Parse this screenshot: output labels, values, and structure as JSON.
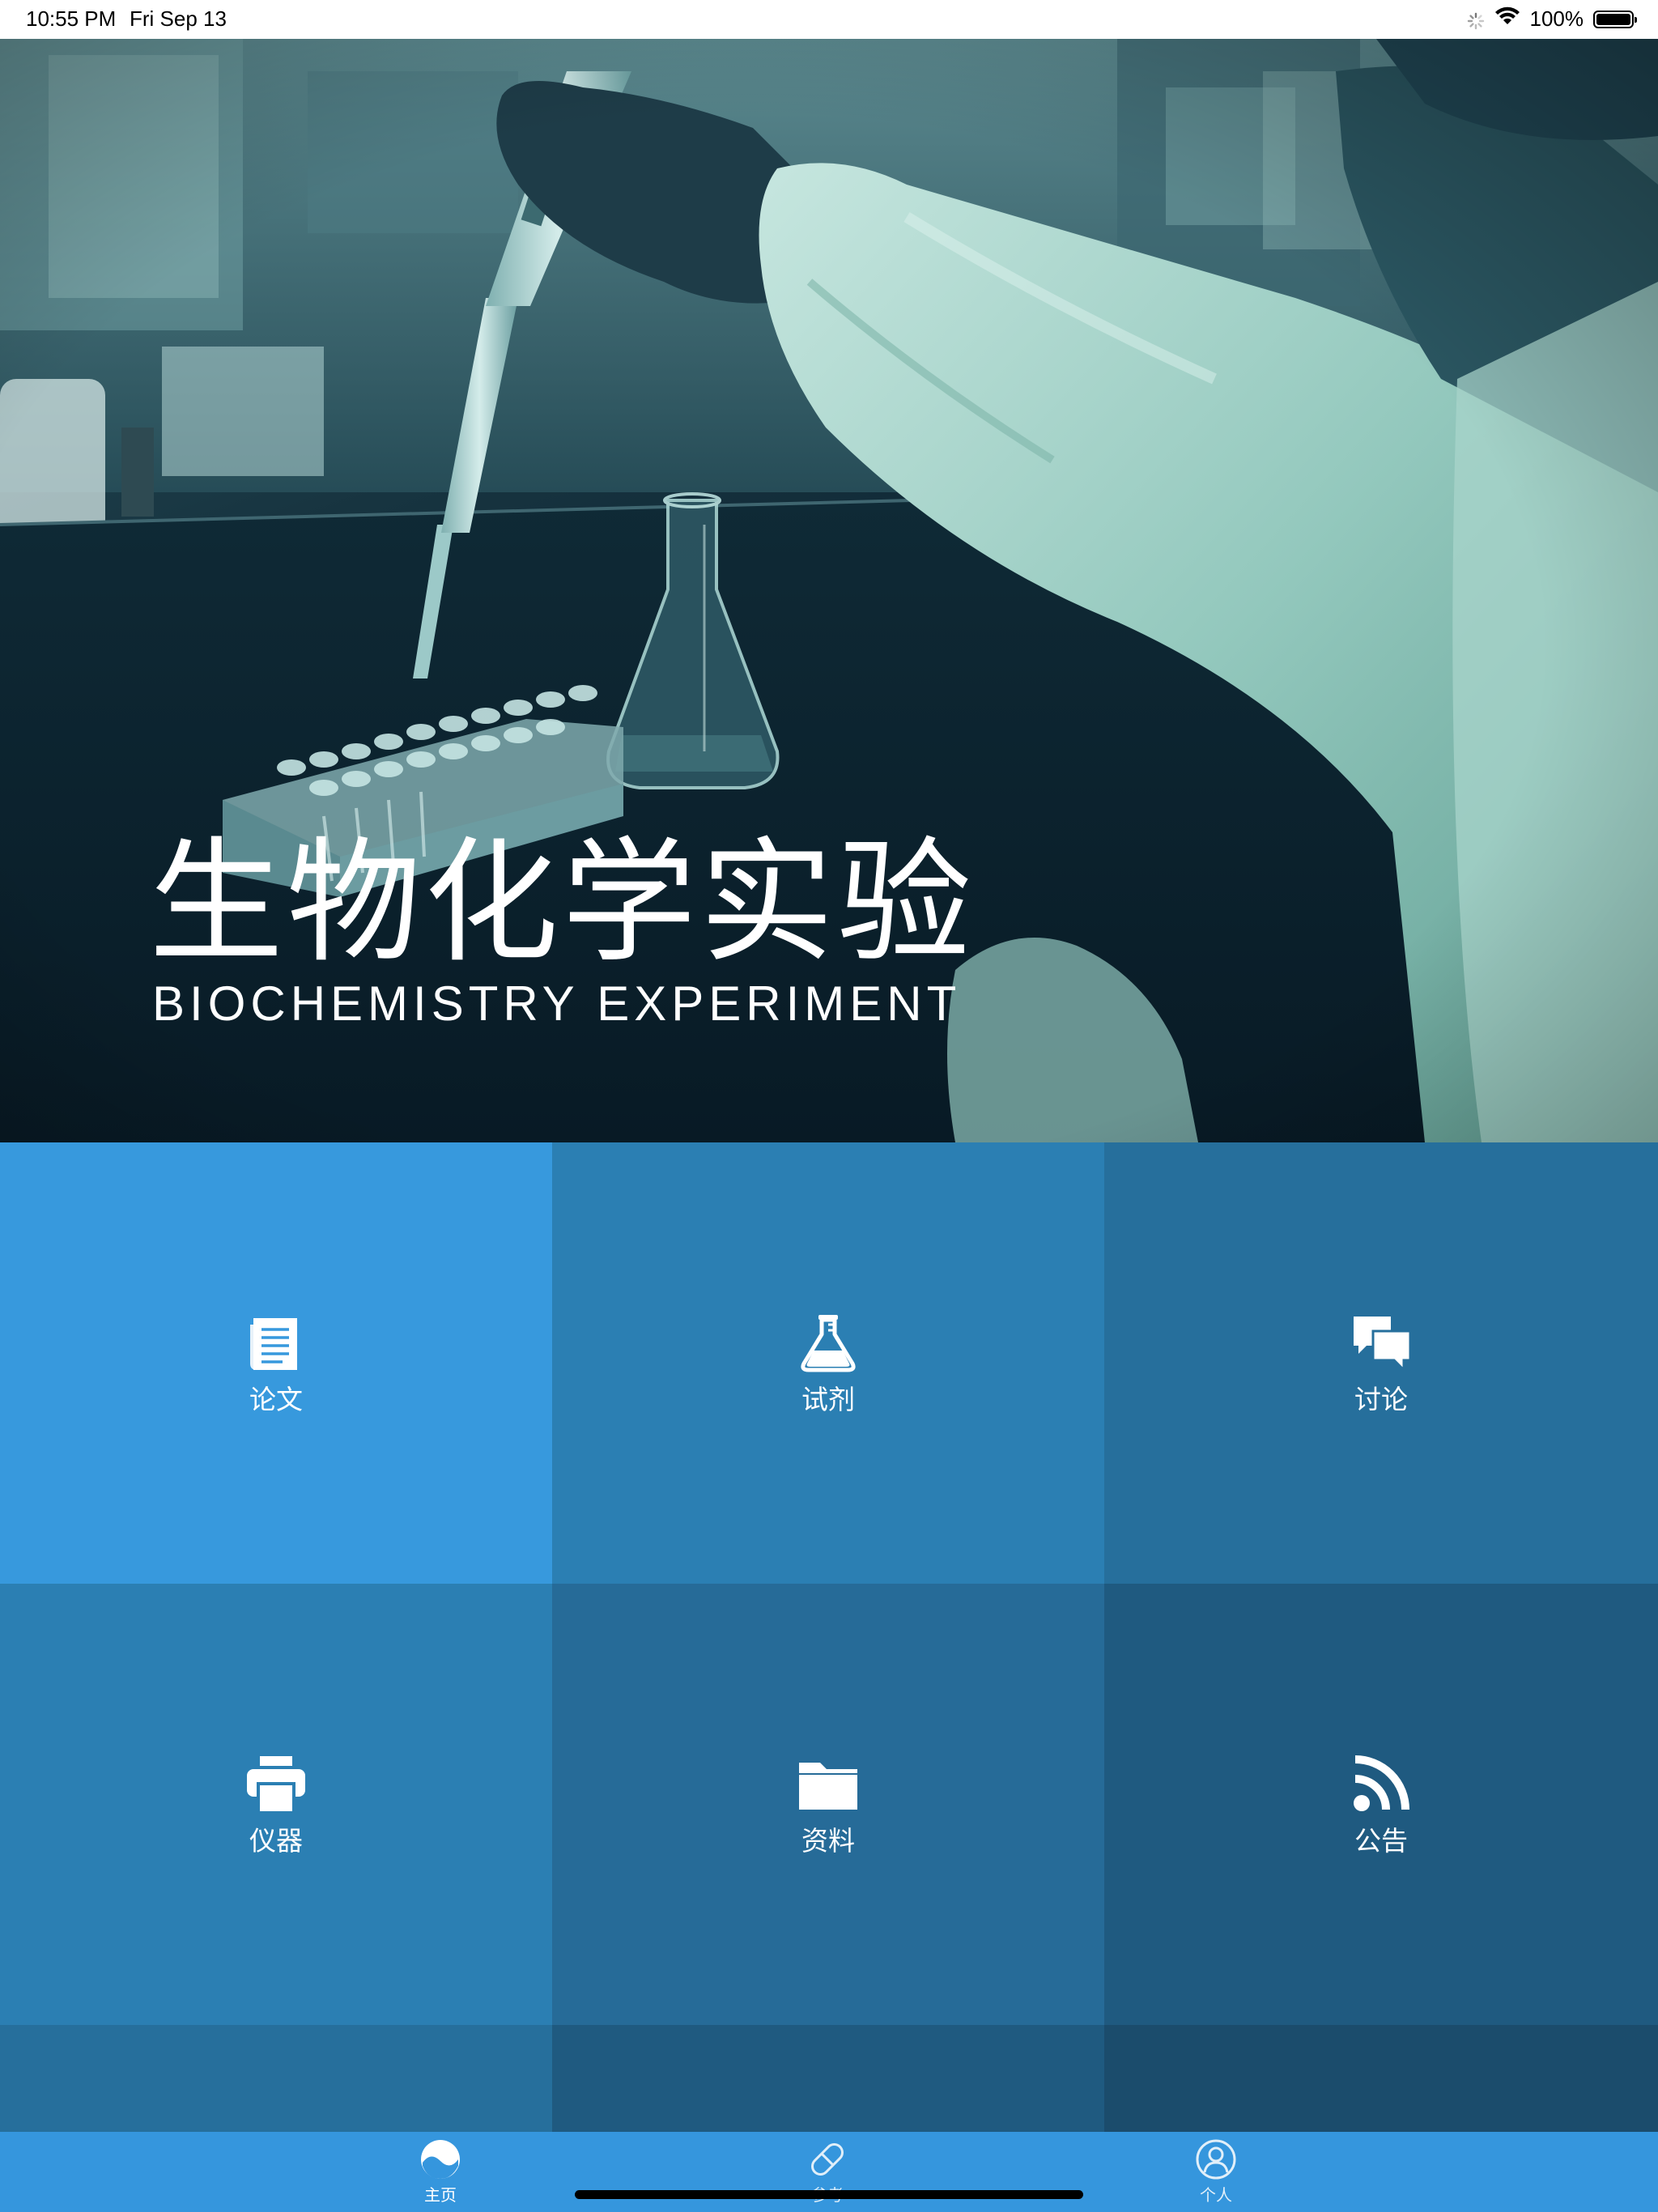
{
  "status_bar": {
    "time": "10:55 PM",
    "date": "Fri Sep 13",
    "battery": "100%",
    "battery_level": 1.0
  },
  "hero": {
    "title": "生物化学实验",
    "subtitle": "BIOCHEMISTRY EXPERIMENT"
  },
  "grid": {
    "tiles": [
      {
        "label": "论文",
        "icon": "document-icon",
        "color": "#3799dd"
      },
      {
        "label": "试剂",
        "icon": "flask-icon",
        "color": "#2b7fb3"
      },
      {
        "label": "讨论",
        "icon": "chat-bubbles-icon",
        "color": "#266f9c"
      },
      {
        "label": "仪器",
        "icon": "printer-icon",
        "color": "#2b7fb3"
      },
      {
        "label": "资料",
        "icon": "folder-icon",
        "color": "#266b98"
      },
      {
        "label": "公告",
        "icon": "rss-icon",
        "color": "#1f5a80"
      }
    ],
    "bottom_row_colors": [
      "#266f9c",
      "#1f5a80",
      "#1b4c6c"
    ]
  },
  "tab_bar": {
    "items": [
      {
        "label": "主页",
        "icon": "home-wave-icon",
        "selected": true
      },
      {
        "label": "参考",
        "icon": "pill-icon",
        "selected": false
      },
      {
        "label": "个人",
        "icon": "person-icon",
        "selected": false
      }
    ]
  }
}
